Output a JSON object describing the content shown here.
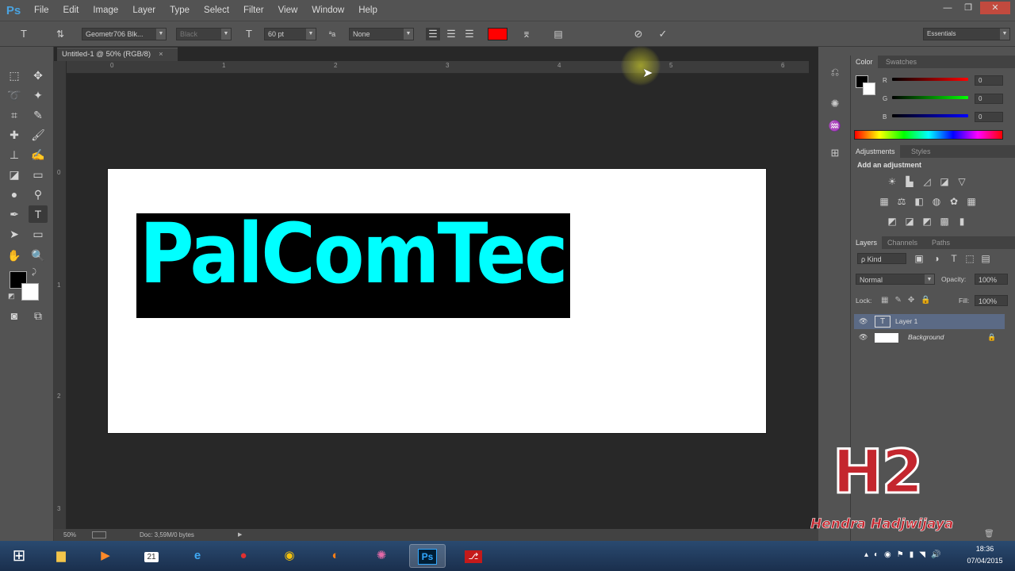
{
  "app": {
    "logo": "Ps"
  },
  "menu": {
    "items": [
      "File",
      "Edit",
      "Image",
      "Layer",
      "Type",
      "Select",
      "Filter",
      "View",
      "Window",
      "Help"
    ]
  },
  "window_controls": {
    "minimize": "—",
    "restore": "❐",
    "close": "✕"
  },
  "options_bar": {
    "font_family": "Geometr706 Blk...",
    "font_style": "Black",
    "font_size": "60 pt",
    "aa_label": "ªa",
    "anti_alias": "None",
    "text_color": "#ff0000",
    "cancel_icon": "cancel-icon",
    "commit_icon": "commit-icon",
    "workspace": "Essentials"
  },
  "document": {
    "tab_title": "Untitled-1 @ 50% (RGB/8)",
    "text_content": "PalComTech",
    "text_color": "#00ffff",
    "text_bg_color": "#000000",
    "zoom": "50%",
    "doc_info": "Doc: 3,59M/0 bytes",
    "ruler_top": [
      "0",
      "1",
      "2",
      "3",
      "4",
      "5",
      "6"
    ],
    "ruler_left": [
      "0",
      "1",
      "2",
      "3"
    ]
  },
  "color_panel": {
    "tabs": [
      "Color",
      "Swatches"
    ],
    "r_label": "R",
    "g_label": "G",
    "b_label": "B",
    "r": "0",
    "g": "0",
    "b": "0"
  },
  "adjustments_panel": {
    "tabs": [
      "Adjustments",
      "Styles"
    ],
    "heading": "Add an adjustment"
  },
  "layers_panel": {
    "tabs": [
      "Layers",
      "Channels",
      "Paths"
    ],
    "filter_kind": "ρ Kind",
    "blend_mode": "Normal",
    "opacity_label": "Opacity:",
    "opacity": "100%",
    "lock_label": "Lock:",
    "fill_label": "Fill:",
    "fill": "100%",
    "layers": [
      {
        "name": "Layer 1",
        "selected": true
      },
      {
        "name": "Background",
        "selected": false
      }
    ]
  },
  "watermark": {
    "logo": "H2",
    "name": "Hendra Hadjwijaya"
  },
  "taskbar": {
    "clock_time": "18:36",
    "clock_date": "07/04/2015",
    "calendar_day": "21"
  }
}
